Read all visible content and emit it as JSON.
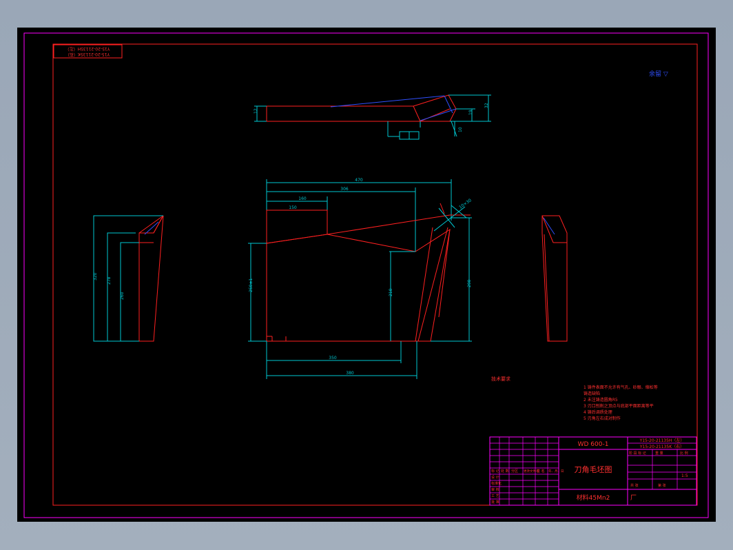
{
  "drawing": {
    "stamp_top_left": [
      "Y15-20-21135H（左）",
      "Y15-20-21135K（右）"
    ],
    "surface_finish": "余留 ▽",
    "dims_top_view": [
      "12",
      "19",
      "32",
      "10",
      "16"
    ],
    "dims_front": {
      "w470": "470",
      "w306": "306",
      "w160": "160",
      "w150": "150",
      "h250": "250±1",
      "h210": "210",
      "h290": "290",
      "b350": "350",
      "b380": "380",
      "ang": "10×30"
    },
    "dims_left": [
      "320",
      "278",
      "260"
    ]
  },
  "tech_req": {
    "title": "技术要求",
    "items": [
      "1  铸件表面不允许有气孔、砂眼、缩松等",
      "   铸造缺陷",
      "2  未注铸造圆角R5",
      "3  刃口刨削之顶点与底部平面距离等平",
      "4  铸后调质处理",
      "5  刃角左右成对制作"
    ]
  },
  "title_block": {
    "model": "WD 600-1",
    "part_no_1": "Y15-20-21135H（左）",
    "part_no_2": "Y15-20-21135K（右）",
    "drawing_name": "刀角毛坯图",
    "material": "材料45Mn2",
    "factory": "厂",
    "labels_left": [
      "标 记",
      "处 数",
      "分区",
      "更改文件号",
      "签 名",
      "年、月、日",
      "设 计",
      "标准化",
      "审 核",
      "工 艺",
      "批 准"
    ],
    "labels_right": [
      "阶 段 标 记",
      "重 量",
      "比 例",
      "共  张",
      "第  张"
    ],
    "scale": "1:5"
  }
}
